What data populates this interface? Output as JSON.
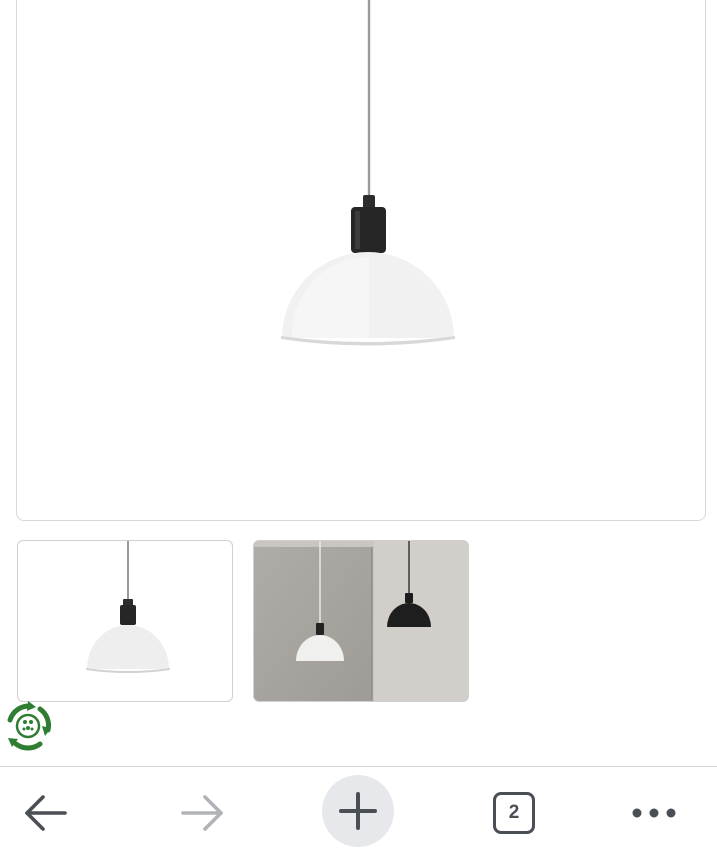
{
  "product_gallery": {
    "main_image_alt": "",
    "thumbnails": [
      {
        "name": "thumbnail-white-pendant"
      },
      {
        "name": "thumbnail-room-pendants"
      }
    ]
  },
  "badge": {
    "icon": "accessibility-badge-icon",
    "color": "#2e7d32"
  },
  "toolbar": {
    "back_icon": "back-arrow-icon",
    "forward_icon": "forward-arrow-icon",
    "new_tab_icon": "plus-icon",
    "tab_count": "2",
    "more_icon": "more-dots-icon",
    "icon_color": "#4a4f55",
    "disabled_color": "#b0b4b8"
  }
}
